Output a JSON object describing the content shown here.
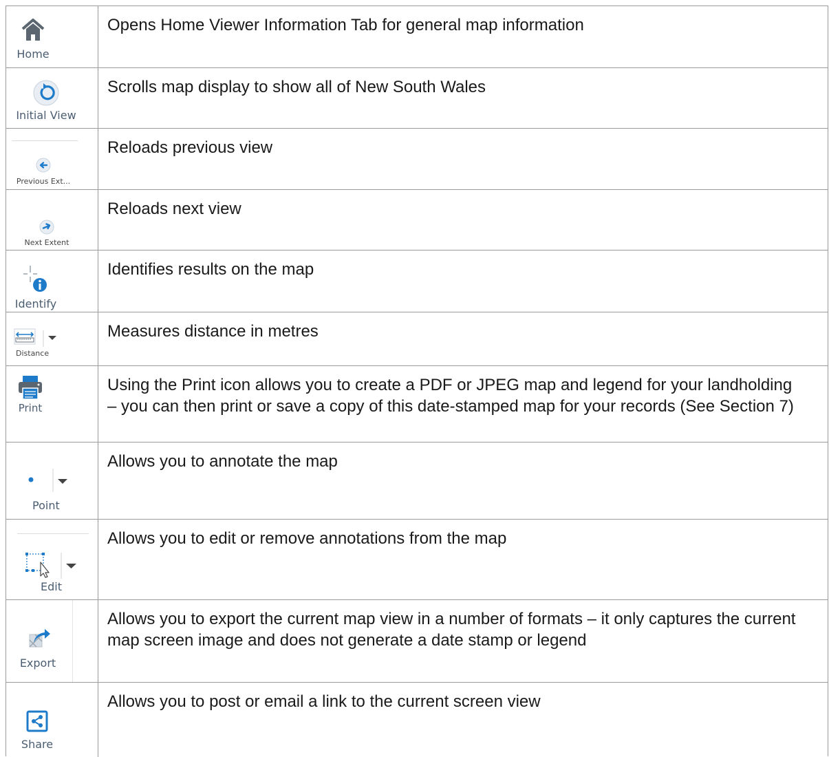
{
  "rows": [
    {
      "tool_label": "Home",
      "icon": "home-icon",
      "description": "Opens Home Viewer Information Tab for general map information"
    },
    {
      "tool_label": "Initial View",
      "icon": "initial-view-icon",
      "description": "Scrolls map display to show all of New South Wales"
    },
    {
      "tool_label": "Previous Ext...",
      "icon": "previous-extent-icon",
      "description": "Reloads previous view"
    },
    {
      "tool_label": "Next Extent",
      "icon": "next-extent-icon",
      "description": "Reloads next view"
    },
    {
      "tool_label": "Identify",
      "icon": "identify-icon",
      "description": "Identifies results on the map"
    },
    {
      "tool_label": "Distance",
      "icon": "measure-distance-icon",
      "description": "Measures distance in metres"
    },
    {
      "tool_label": "Print",
      "icon": "printer-icon",
      "description": "Using the Print icon allows you to create a PDF or JPEG map and legend for your landholding – you can then print or save a copy of this date-stamped map for your records (See Section 7)"
    },
    {
      "tool_label": "Point",
      "icon": "point-icon",
      "description": "Allows you to annotate the map"
    },
    {
      "tool_label": "Edit",
      "icon": "edit-select-icon",
      "description": "Allows you to edit or remove annotations from the map"
    },
    {
      "tool_label": "Export",
      "icon": "export-icon",
      "description": "Allows you to export the current map view in a number of formats – it only captures the current map screen image and does not generate a date stamp or legend"
    },
    {
      "tool_label": "Share",
      "icon": "share-icon",
      "description": "Allows you to post or email a link to the current screen view"
    }
  ],
  "colors": {
    "icon_blue": "#1e7bc9",
    "icon_gray": "#5b6670",
    "label": "#4b5d70",
    "border": "#9a9a9a"
  }
}
